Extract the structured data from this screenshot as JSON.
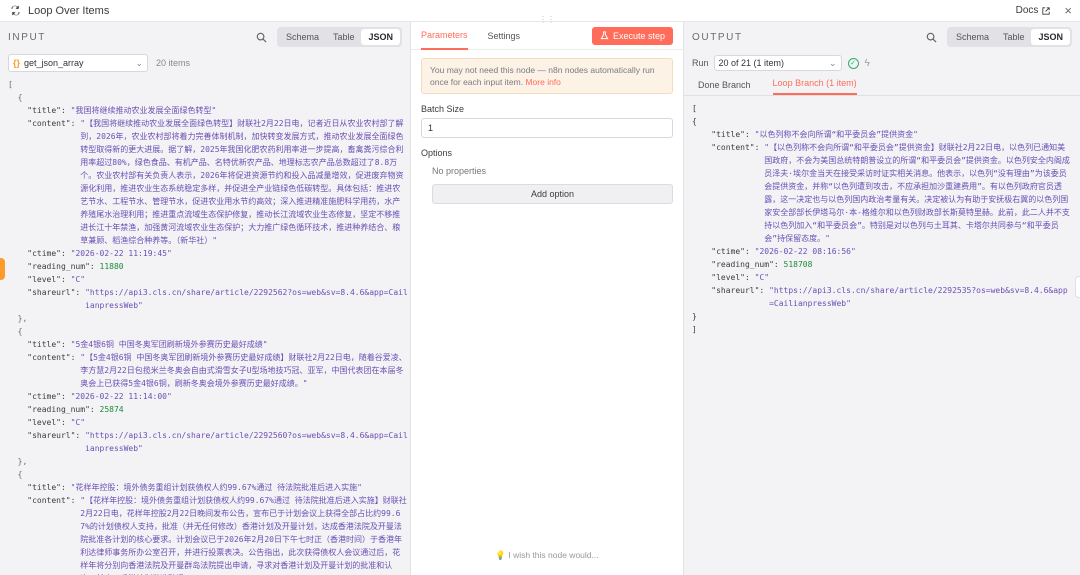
{
  "window": {
    "title": "Loop Over Items",
    "docs_label": "Docs",
    "close_label": "×"
  },
  "input": {
    "label": "INPUT",
    "view_tabs": [
      "Schema",
      "Table",
      "JSON"
    ],
    "active_view": "JSON",
    "node_select": "get_json_array",
    "item_count": "20 items",
    "items": [
      {
        "title": "\"我国将继续推动农业发展全面绿色转型\"",
        "content": "\"【我国将继续推动农业发展全面绿色转型】财联社2月22日电，记者近日从农业农村部了解到，2026年，农业农村部将着力完善体制机制，加快转变发展方式，推动农业发展全面绿色转型取得新的更大进展。据了解，2025年我国化肥农药利用率进一步提高，畜禽粪污综合利用率超过80%，绿色食品、有机产品、名特优新农产品、地理标志农产品总数超过了8.8万个。农业农村部有关负责人表示，2026年将促进资源节约和投入品减量增效，促进废弃物资源化利用，推进农业生态系统稳定多样，并促进全产业链绿色低碳转型。具体包括：推进农艺节水、工程节水、管理节水，促进农业用水节约高效；深入推进精准施肥科学用药，水产养殖尾水治理利用；推进重点流域生态保护修复，推动长江流域农业生态修复，坚定不移推进长江十年禁渔，加强黄河流域农业生态保护；大力推广绿色循环技术，推进种养结合、粮草兼顾、稻渔综合种养等。（新华社）\"",
        "ctime": "\"2026-02-22 11:19:45\"",
        "reading_num": "11880",
        "level": "\"C\"",
        "shareurl": "\"https://api3.cls.cn/share/article/2292562?os=web&sv=8.4.6&app=CailianpressWeb\""
      },
      {
        "title": "\"5金4银6铜  中国冬奥军团刷新境外参赛历史最好成绩\"",
        "content": "\"【5金4银6铜  中国冬奥军团刷新境外参赛历史最好成绩】财联社2月22日电，随着谷爱凌、李方慧2月22日包揽米兰冬奥会自由式滑雪女子U型场地技巧冠、亚军，中国代表团在本届冬奥会上已获得5金4银6铜，刷新冬奥会境外参赛历史最好成绩。\"",
        "ctime": "\"2026-02-22 11:14:00\"",
        "reading_num": "25874",
        "level": "\"C\"",
        "shareurl": "\"https://api3.cls.cn/share/article/2292560?os=web&sv=8.4.6&app=CailianpressWeb\""
      },
      {
        "title": "\"花样年控股：境外债务重组计划获债权人约99.67%通过  待法院批准后进入实施\"",
        "content": "\"【花样年控股：境外债务重组计划获债权人约99.67%通过  待法院批准后进入实施】财联社2月22日电，花样年控股2月22日晚间发布公告，宣布已于计划会议上获得全部占比约99.67%的计划债权人支持，批准（并无任何修改）香港计划及开曼计划，达成香港法院及开曼法院批准各计划的核心要求。计划会议已于2026年2月20日下午七时正（香港时间）于香港年利达律师事务所办公室召开，并进行投票表决。公告指出，此次获得债权人会议通过后，花样年将分别向香港法院及开曼群岛法院提出申请，寻求对香港计划及开曼计划的批准和认许。其中，香港计划批准聆讯\""
      }
    ]
  },
  "params": {
    "tabs": [
      "Parameters",
      "Settings"
    ],
    "active_tab": "Parameters",
    "execute_label": "Execute step",
    "notice_text": "You may not need this node — n8n nodes automatically run once for each input item.",
    "notice_link": "More info",
    "batch_size_label": "Batch Size",
    "batch_size_value": "1",
    "options_label": "Options",
    "no_properties": "No properties",
    "add_option": "Add option",
    "wish_text": "I wish this node would..."
  },
  "output": {
    "label": "OUTPUT",
    "view_tabs": [
      "Schema",
      "Table",
      "JSON"
    ],
    "active_view": "JSON",
    "run_label": "Run",
    "run_value": "20 of 21 (1 item)",
    "branch_tabs": [
      "Done Branch",
      "Loop Branch (1 item)"
    ],
    "active_branch": "Loop Branch (1 item)",
    "item": {
      "title": "\"以色列称不会向所谓“和平委员会”提供资金\"",
      "content": "\"【以色列称不会向所谓“和平委员会”提供资金】财联社2月22日电，以色列已通知美国政府，不会为美国总统特朗普设立的所谓“和平委员会”提供资金。以色列安全内阁成员泽夫·埃尔金当天在接受采访时证实相关消息。他表示，以色列“没有理由”为该委员会提供资金，并称“以色列遭到攻击，不应承担加沙重建费用”。有以色列政府官员透露，这一决定也与以色列国内政治考量有关。决定被认为有助于安抚极右翼的以色列国家安全部部长伊塔马尔·本-格维尔和以色列财政部长斯莫特里赫。此前，此二人并不支持以色列加入“和平委员会”。特别是对以色列与土耳其、卡塔尔共同参与“和平委员会”持保留态度。\"",
      "ctime": "\"2026-02-22 08:16:56\"",
      "reading_num": "518708",
      "level": "\"C\"",
      "shareurl": "\"https://api3.cls.cn/share/article/2292535?os=web&sv=8.4.6&app=CailianpressWeb\""
    }
  }
}
